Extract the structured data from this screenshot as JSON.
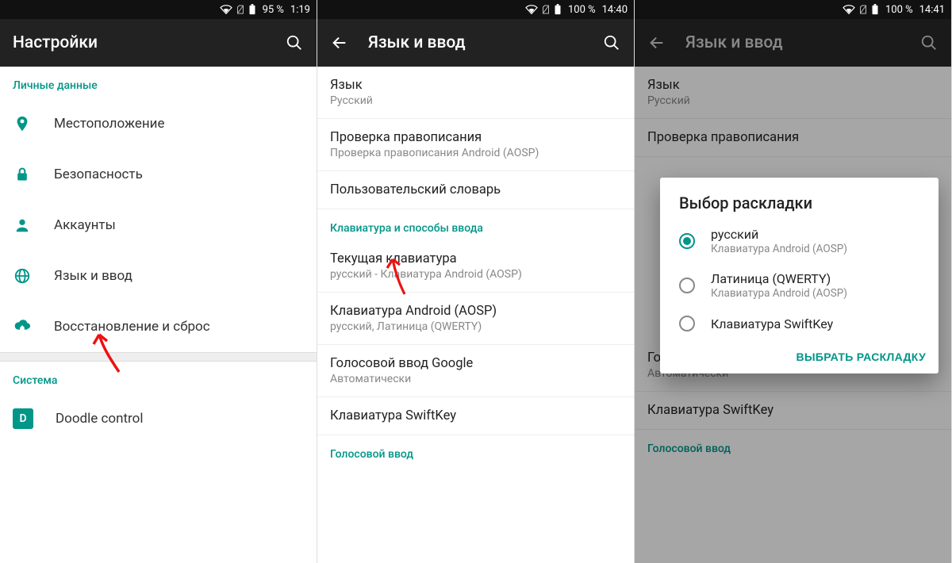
{
  "accent": "#009688",
  "screen1": {
    "status": {
      "battery": "95 %",
      "time": "1:19"
    },
    "title": "Настройки",
    "section_personal": "Личные данные",
    "items_personal": [
      {
        "icon": "location-icon",
        "label": "Местоположение"
      },
      {
        "icon": "lock-icon",
        "label": "Безопасность"
      },
      {
        "icon": "account-icon",
        "label": "Аккаунты"
      },
      {
        "icon": "globe-icon",
        "label": "Язык и ввод"
      },
      {
        "icon": "backup-icon",
        "label": "Восстановление и сброс"
      }
    ],
    "section_system": "Система",
    "items_system": [
      {
        "icon": "D",
        "label": "Doodle control"
      }
    ]
  },
  "screen2": {
    "status": {
      "battery": "100 %",
      "time": "14:40"
    },
    "title": "Язык и ввод",
    "rows": [
      {
        "title": "Язык",
        "sub": "Русский"
      },
      {
        "title": "Проверка правописания",
        "sub": "Проверка правописания Android (AOSP)"
      },
      {
        "title": "Пользовательский словарь",
        "sub": ""
      }
    ],
    "subheader": "Клавиатура и способы ввода",
    "rows2": [
      {
        "title": "Текущая клавиатура",
        "sub": "русский - Клавиатура Android (AOSP)"
      },
      {
        "title": "Клавиатура Android (AOSP)",
        "sub": "русский, Латиница (QWERTY)"
      },
      {
        "title": "Голосовой ввод Google",
        "sub": "Автоматически"
      },
      {
        "title": "Клавиатура SwiftKey",
        "sub": ""
      }
    ],
    "subheader2": "Голосовой ввод"
  },
  "screen3": {
    "status": {
      "battery": "100 %",
      "time": "14:41"
    },
    "title": "Язык и ввод",
    "rows": [
      {
        "title": "Язык",
        "sub": "Русский"
      },
      {
        "title": "Проверка правописания",
        "sub": ""
      }
    ],
    "rows2": [
      {
        "title": "Голосовой ввод Google",
        "sub": "Автоматически"
      },
      {
        "title": "Клавиатура SwiftKey",
        "sub": ""
      }
    ],
    "subheader2": "Голосовой ввод",
    "dialog": {
      "title": "Выбор раскладки",
      "options": [
        {
          "title": "русский",
          "sub": "Клавиатура Android (AOSP)",
          "checked": true
        },
        {
          "title": "Латиница (QWERTY)",
          "sub": "Клавиатура Android (AOSP)",
          "checked": false
        },
        {
          "title": "Клавиатура SwiftKey",
          "sub": "",
          "checked": false
        }
      ],
      "action": "ВЫБРАТЬ РАСКЛАДКУ"
    }
  }
}
